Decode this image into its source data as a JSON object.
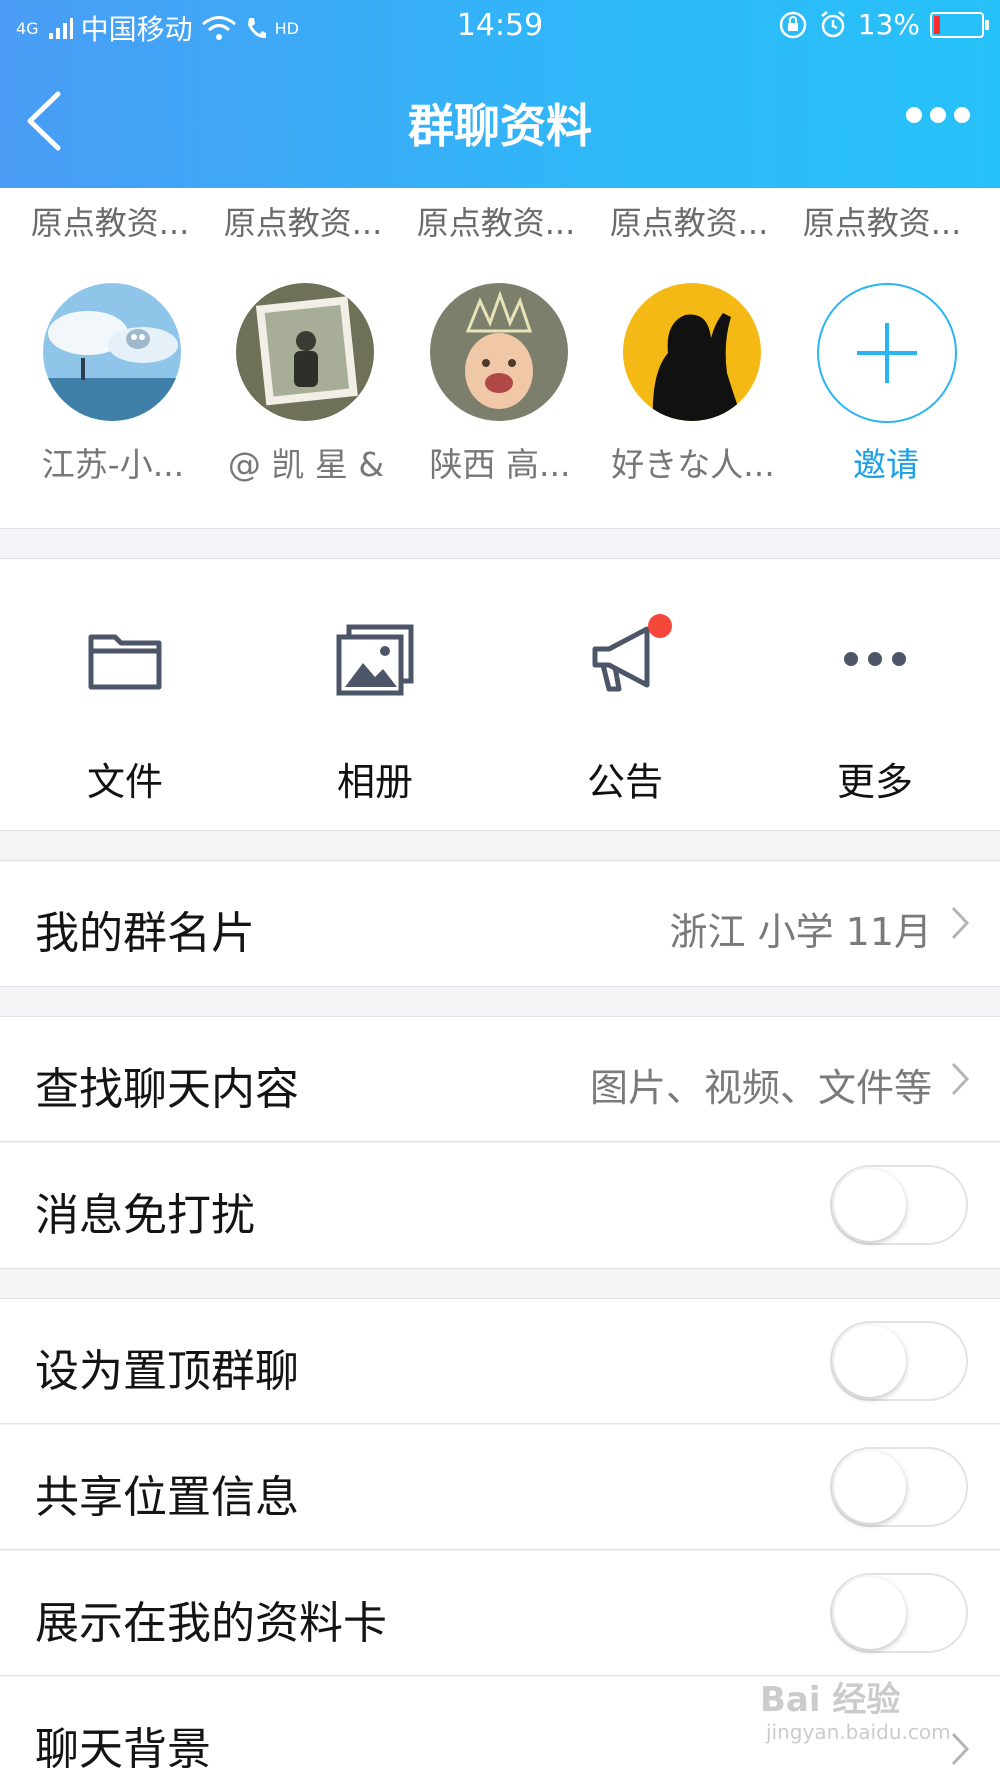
{
  "status_bar": {
    "carrier": "中国移动",
    "network": "4G",
    "time": "14:59",
    "battery": "13%",
    "hd": "HD"
  },
  "nav": {
    "title": "群聊资料"
  },
  "members": {
    "truncated_names": [
      "原点教资...",
      "原点教资...",
      "原点教资...",
      "原点教资...",
      "原点教资..."
    ],
    "people": [
      {
        "name": "江苏-小..."
      },
      {
        "name": "@ 凯  星 &"
      },
      {
        "name": "陕西 高..."
      },
      {
        "name": "好きな人..."
      }
    ],
    "invite_label": "邀请"
  },
  "tools": [
    {
      "label": "文件",
      "icon": "folder-icon"
    },
    {
      "label": "相册",
      "icon": "album-icon"
    },
    {
      "label": "公告",
      "icon": "megaphone-icon"
    },
    {
      "label": "更多",
      "icon": "more-icon"
    }
  ],
  "rows": {
    "group_card": {
      "label": "我的群名片",
      "value": "浙江  小学  11月"
    },
    "search_chat": {
      "label": "查找聊天内容",
      "value": "图片、视频、文件等"
    },
    "do_not_disturb": {
      "label": "消息免打扰",
      "on": false
    },
    "pin_chat": {
      "label": "设为置顶群聊",
      "on": false
    },
    "share_location": {
      "label": "共享位置信息",
      "on": false
    },
    "show_on_card": {
      "label": "展示在我的资料卡",
      "on": false
    },
    "chat_background": {
      "label": "聊天背景"
    }
  },
  "watermark": {
    "text": "Bai 经验",
    "url": "jingyan.baidu.com"
  },
  "colors": {
    "header_start": "#4a9cf5",
    "header_end": "#27c1f9",
    "accent": "#29b5f3",
    "badge": "#f5473a"
  }
}
